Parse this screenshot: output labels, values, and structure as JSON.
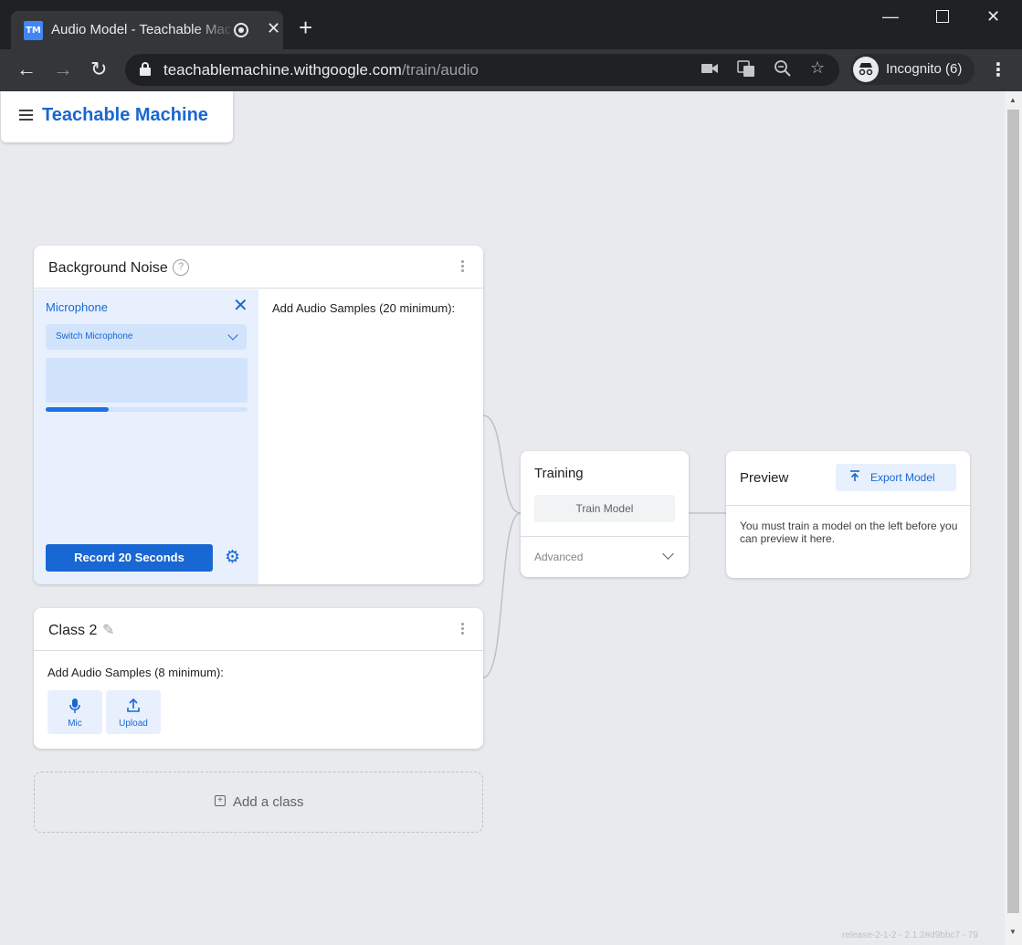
{
  "browser": {
    "tab_title": "Audio Model - Teachable Machine",
    "favicon_text": "TM",
    "new_tab": "+",
    "url_host": "teachablemachine.withgoogle.com",
    "url_path": "/train/audio",
    "profile_label": "Incognito (6)"
  },
  "app": {
    "brand": "Teachable Machine",
    "version": "release-2-1-2 - 2.1.2#d9bbc7 - 79"
  },
  "classes": [
    {
      "name": "Background Noise",
      "help": "?",
      "microphone": {
        "title": "Microphone",
        "select_label": "Switch Microphone",
        "recording_progress": 0.31,
        "record_button": "Record 20 Seconds"
      },
      "samples_title": "Add Audio Samples (20 minimum):"
    },
    {
      "name": "Class 2",
      "samples_title": "Add Audio Samples (8 minimum):",
      "buttons": [
        {
          "label": "Mic",
          "icon": "mic-icon"
        },
        {
          "label": "Upload",
          "icon": "upload-icon"
        }
      ]
    }
  ],
  "add_class": "Add a class",
  "training": {
    "title": "Training",
    "train_button": "Train Model",
    "advanced": "Advanced"
  },
  "preview": {
    "title": "Preview",
    "export_button": "Export Model",
    "message": "You must train a model on the left before you can preview it here."
  },
  "colors": {
    "accent": "#1967d2",
    "accent_light": "#e8f0fe",
    "page_bg": "#e8eaed"
  }
}
